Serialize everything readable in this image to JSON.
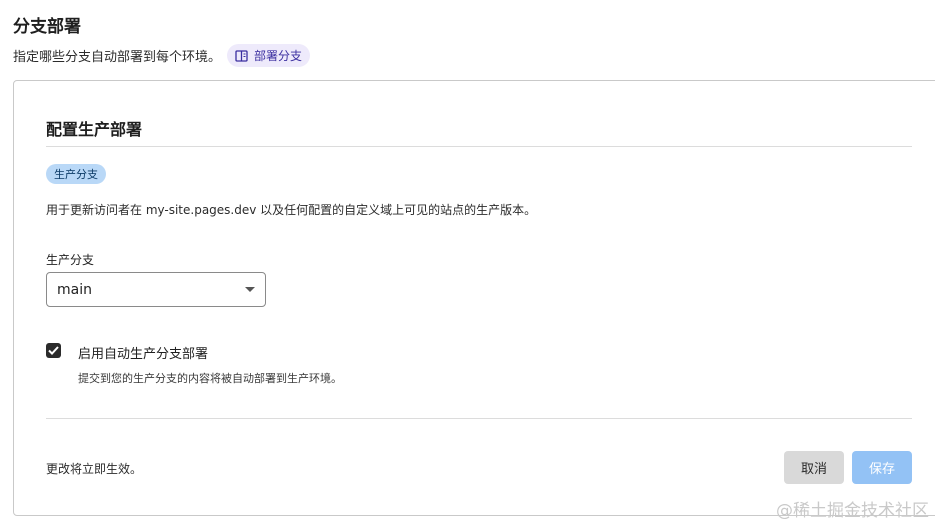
{
  "section": {
    "title": "分支部署",
    "description": "指定哪些分支自动部署到每个环境。",
    "docs_link_label": "部署分支",
    "docs_icon": "book-icon"
  },
  "card": {
    "title": "配置生产部署",
    "badge": "生产分支",
    "description": "用于更新访问者在 my-site.pages.dev 以及任何配置的自定义域上可见的站点的生产版本。",
    "branch_field": {
      "label": "生产分支",
      "value": "main"
    },
    "auto_deploy": {
      "checked": true,
      "label": "启用自动生产分支部署",
      "help": "提交到您的生产分支的内容将被自动部署到生产环境。"
    },
    "footer_note": "更改将立即生效。",
    "cancel_label": "取消",
    "save_label": "保存"
  },
  "watermark": "@稀土掘金技术社区",
  "colors": {
    "save_button": "#93c2f5",
    "cancel_button": "#d9d9d9",
    "badge_bg": "#b9d8f7",
    "docs_pill_bg": "#eeeafb"
  }
}
